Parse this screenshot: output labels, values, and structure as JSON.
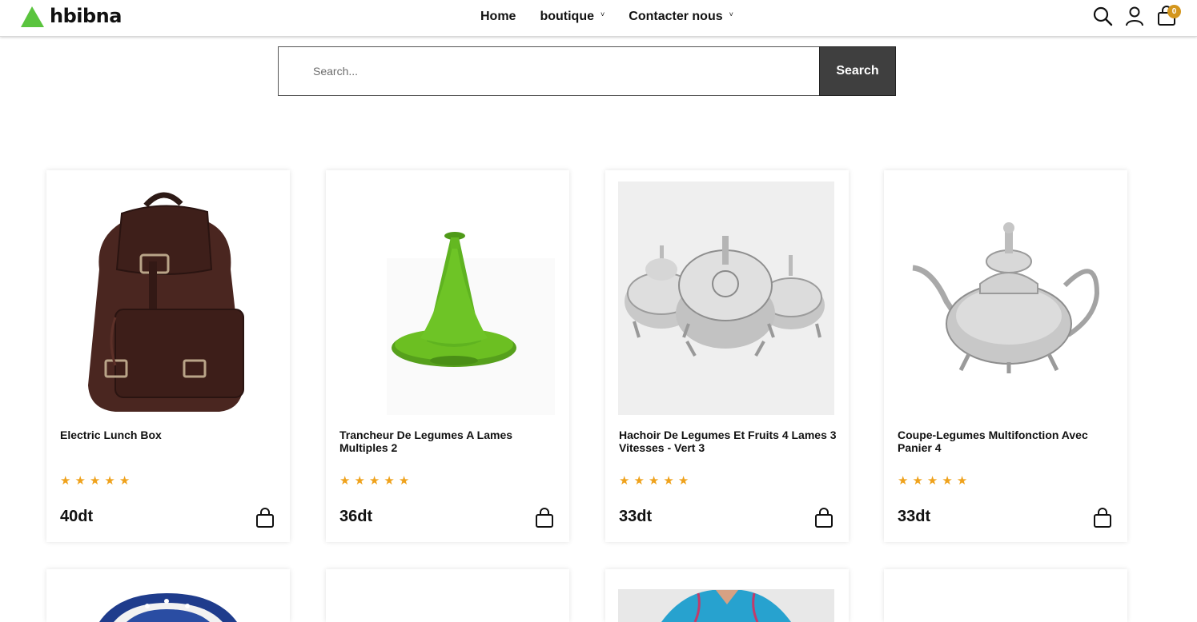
{
  "brand": {
    "name": "hbibna",
    "accent": "#5ac43e"
  },
  "nav": {
    "items": [
      {
        "label": "Home",
        "has_dropdown": false
      },
      {
        "label": "boutique",
        "has_dropdown": true
      },
      {
        "label": "Contacter nous",
        "has_dropdown": true
      }
    ]
  },
  "header_icons": {
    "search": "search-icon",
    "account": "user-icon",
    "cart": "shopping-bag-icon",
    "cart_count": "0",
    "badge_color": "#d4961c"
  },
  "search": {
    "placeholder": "Search...",
    "value": "",
    "button_label": "Search"
  },
  "products": [
    {
      "title": "Electric Lunch Box",
      "rating": 5,
      "price": "40dt",
      "image": "leather-backpack"
    },
    {
      "title": "Trancheur De Legumes A Lames Multiples 2",
      "rating": 5,
      "price": "36dt",
      "image": "green-tagine"
    },
    {
      "title": "Hachoir De Legumes Et Fruits 4 Lames 3 Vitesses - Vert 3",
      "rating": 5,
      "price": "33dt",
      "image": "silver-bowls"
    },
    {
      "title": "Coupe-Legumes Multifonction Avec Panier 4",
      "rating": 5,
      "price": "33dt",
      "image": "silver-teapot"
    }
  ],
  "products_row2_images": [
    "blue-ceramic-plate",
    "blank",
    "blue-kaftan",
    "blank"
  ],
  "star_color": "#efa21c"
}
